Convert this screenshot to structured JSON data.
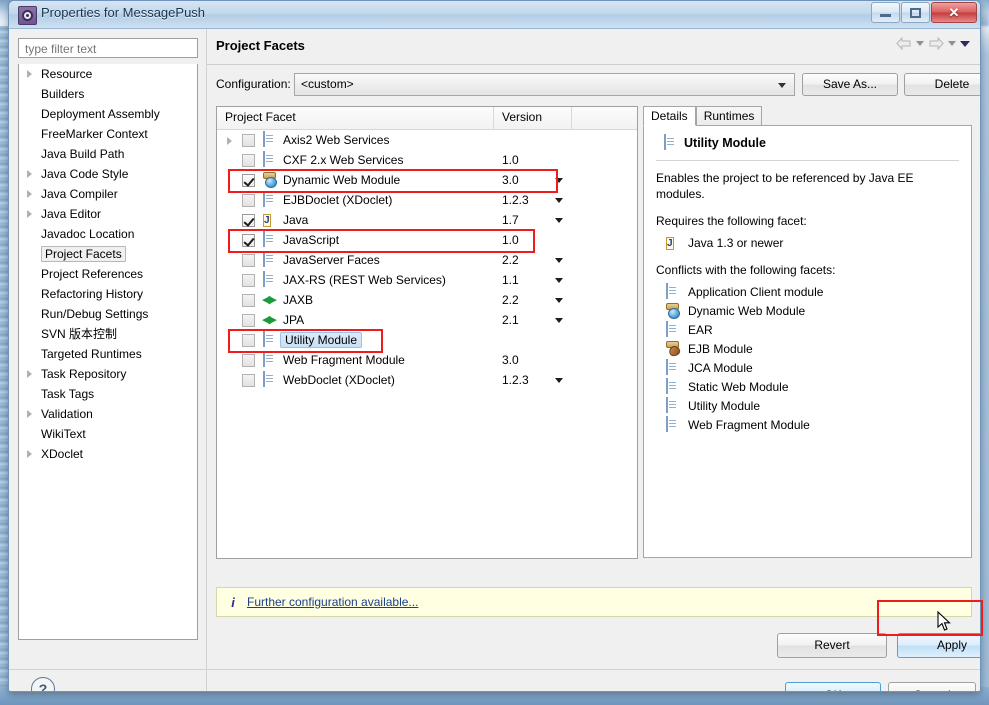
{
  "window": {
    "title": "Properties for MessagePush",
    "icon": "gear-icon",
    "minimize_label": "Minimize",
    "maximize_label": "Maximize",
    "close_label": "Close"
  },
  "sidebar": {
    "filter_placeholder": "type filter text",
    "filter_value": "",
    "items": [
      {
        "label": "Resource",
        "expandable": true,
        "selected": false
      },
      {
        "label": "Builders",
        "expandable": false,
        "selected": false
      },
      {
        "label": "Deployment Assembly",
        "expandable": false,
        "selected": false
      },
      {
        "label": "FreeMarker Context",
        "expandable": false,
        "selected": false
      },
      {
        "label": "Java Build Path",
        "expandable": false,
        "selected": false
      },
      {
        "label": "Java Code Style",
        "expandable": true,
        "selected": false
      },
      {
        "label": "Java Compiler",
        "expandable": true,
        "selected": false
      },
      {
        "label": "Java Editor",
        "expandable": true,
        "selected": false
      },
      {
        "label": "Javadoc Location",
        "expandable": false,
        "selected": false
      },
      {
        "label": "Project Facets",
        "expandable": false,
        "selected": true
      },
      {
        "label": "Project References",
        "expandable": false,
        "selected": false
      },
      {
        "label": "Refactoring History",
        "expandable": false,
        "selected": false
      },
      {
        "label": "Run/Debug Settings",
        "expandable": false,
        "selected": false
      },
      {
        "label": "SVN 版本控制",
        "expandable": false,
        "selected": false
      },
      {
        "label": "Targeted Runtimes",
        "expandable": false,
        "selected": false
      },
      {
        "label": "Task Repository",
        "expandable": true,
        "selected": false
      },
      {
        "label": "Task Tags",
        "expandable": false,
        "selected": false
      },
      {
        "label": "Validation",
        "expandable": true,
        "selected": false
      },
      {
        "label": "WikiText",
        "expandable": false,
        "selected": false
      },
      {
        "label": "XDoclet",
        "expandable": true,
        "selected": false
      }
    ]
  },
  "page": {
    "title": "Project Facets",
    "nav": {
      "back_icon": "arrow-left-icon",
      "back_menu_icon": "chevron-down-icon",
      "forward_icon": "arrow-right-icon",
      "forward_menu_icon": "chevron-down-icon",
      "view_menu_icon": "chevron-down-icon"
    }
  },
  "configuration": {
    "label": "Configuration:",
    "value": "<custom>",
    "save_as_label": "Save As...",
    "delete_label": "Delete"
  },
  "facet_table": {
    "columns": [
      "Project Facet",
      "Version"
    ],
    "rows": [
      {
        "name": "Axis2 Web Services",
        "version": "",
        "checked": false,
        "expandable": true,
        "has_version_menu": false,
        "icon": "document-icon",
        "highlighted": false,
        "selected": false
      },
      {
        "name": "CXF 2.x Web Services",
        "version": "1.0",
        "checked": false,
        "expandable": false,
        "has_version_menu": false,
        "icon": "document-icon",
        "highlighted": false,
        "selected": false
      },
      {
        "name": "Dynamic Web Module",
        "version": "3.0",
        "checked": true,
        "expandable": false,
        "has_version_menu": true,
        "icon": "dynamic-web-module-icon",
        "highlighted": true,
        "selected": false
      },
      {
        "name": "EJBDoclet (XDoclet)",
        "version": "1.2.3",
        "checked": false,
        "expandable": false,
        "has_version_menu": true,
        "icon": "document-icon",
        "highlighted": false,
        "selected": false
      },
      {
        "name": "Java",
        "version": "1.7",
        "checked": true,
        "expandable": false,
        "has_version_menu": true,
        "icon": "java-icon",
        "highlighted": false,
        "selected": false
      },
      {
        "name": "JavaScript",
        "version": "1.0",
        "checked": true,
        "expandable": false,
        "has_version_menu": false,
        "icon": "document-icon",
        "highlighted": true,
        "selected": false
      },
      {
        "name": "JavaServer Faces",
        "version": "2.2",
        "checked": false,
        "expandable": false,
        "has_version_menu": true,
        "icon": "document-icon",
        "highlighted": false,
        "selected": false
      },
      {
        "name": "JAX-RS (REST Web Services)",
        "version": "1.1",
        "checked": false,
        "expandable": false,
        "has_version_menu": true,
        "icon": "document-icon",
        "highlighted": false,
        "selected": false
      },
      {
        "name": "JAXB",
        "version": "2.2",
        "checked": false,
        "expandable": false,
        "has_version_menu": true,
        "icon": "arrows-icon",
        "highlighted": false,
        "selected": false
      },
      {
        "name": "JPA",
        "version": "2.1",
        "checked": false,
        "expandable": false,
        "has_version_menu": true,
        "icon": "arrows-icon",
        "highlighted": false,
        "selected": false
      },
      {
        "name": "Utility Module",
        "version": "",
        "checked": false,
        "expandable": false,
        "has_version_menu": false,
        "icon": "document-icon",
        "highlighted": true,
        "selected": true
      },
      {
        "name": "Web Fragment Module",
        "version": "3.0",
        "checked": false,
        "expandable": false,
        "has_version_menu": false,
        "icon": "document-icon",
        "highlighted": false,
        "selected": false
      },
      {
        "name": "WebDoclet (XDoclet)",
        "version": "1.2.3",
        "checked": false,
        "expandable": false,
        "has_version_menu": true,
        "icon": "document-icon",
        "highlighted": false,
        "selected": false
      }
    ]
  },
  "details": {
    "tabs": [
      {
        "label": "Details",
        "active": true
      },
      {
        "label": "Runtimes",
        "active": false
      }
    ],
    "title": "Utility Module",
    "title_icon": "document-icon",
    "description": "Enables the project to be referenced by Java EE modules.",
    "requires_heading": "Requires the following facet:",
    "requires": [
      {
        "label": "Java 1.3 or newer",
        "icon": "java-icon"
      }
    ],
    "conflicts_heading": "Conflicts with the following facets:",
    "conflicts": [
      {
        "label": "Application Client module",
        "icon": "document-icon"
      },
      {
        "label": "Dynamic Web Module",
        "icon": "dynamic-web-module-icon"
      },
      {
        "label": "EAR",
        "icon": "document-icon"
      },
      {
        "label": "EJB Module",
        "icon": "ejb-module-icon"
      },
      {
        "label": "JCA Module",
        "icon": "document-icon"
      },
      {
        "label": "Static Web Module",
        "icon": "document-icon"
      },
      {
        "label": "Utility Module",
        "icon": "document-icon"
      },
      {
        "label": "Web Fragment Module",
        "icon": "document-icon"
      }
    ]
  },
  "info_bar": {
    "icon": "info-icon",
    "link_text": "Further configuration available..."
  },
  "buttons": {
    "revert": "Revert",
    "apply": "Apply",
    "ok": "OK",
    "cancel": "Cancel",
    "help_icon": "help-icon"
  },
  "annotations": {
    "highlight_color": "#ee1c1c",
    "boxes": [
      {
        "target": "dynamic-web-module-row"
      },
      {
        "target": "javascript-row"
      },
      {
        "target": "utility-module-row"
      },
      {
        "target": "apply-button"
      }
    ]
  }
}
